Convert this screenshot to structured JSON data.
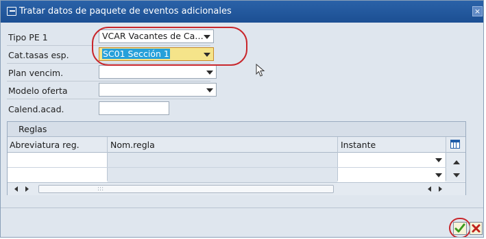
{
  "dialog": {
    "title": "Tratar datos de paquete de eventos adicionales",
    "close_symbol": "×"
  },
  "form": {
    "fields": [
      {
        "label": "Tipo PE 1",
        "value": "VCAR Vacantes de Ca…"
      },
      {
        "label": "Cat.tasas esp.",
        "value": "SC01 Sección 1"
      },
      {
        "label": "Plan vencim.",
        "value": ""
      },
      {
        "label": "Modelo oferta",
        "value": ""
      },
      {
        "label": "Calend.acad.",
        "value": ""
      }
    ]
  },
  "table": {
    "caption": "Reglas",
    "columns": [
      "Abreviatura reg.",
      "Nom.regla",
      "Instante"
    ],
    "rows": [
      {
        "abbr": "",
        "name": "",
        "instant": ""
      },
      {
        "abbr": "",
        "name": "",
        "instant": ""
      }
    ],
    "scroll_grip": ":::"
  },
  "colors": {
    "titlebar": "#1c4f93",
    "highlight_ring": "#c8262b",
    "focused_field": "#f5e48a",
    "selection": "#26a0da"
  },
  "icons": {
    "title": "dialog-icon",
    "ok": "checkmark-icon",
    "cancel": "cancel-x-icon",
    "table_settings": "table-settings-icon"
  }
}
